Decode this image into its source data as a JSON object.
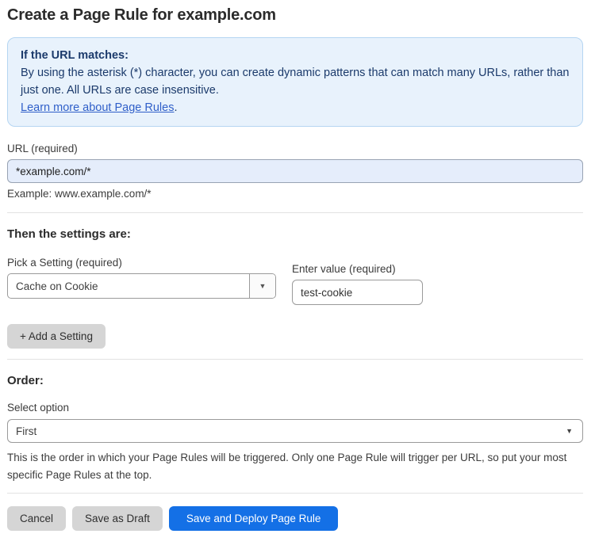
{
  "header": {
    "title": "Create a Page Rule for example.com"
  },
  "info_box": {
    "heading": "If the URL matches:",
    "body": "By using the asterisk (*) character, you can create dynamic patterns that can match many URLs, rather than just one. All URLs are case insensitive.",
    "link_label": "Learn more about Page Rules",
    "link_suffix": "."
  },
  "url_field": {
    "label": "URL (required)",
    "value": "*example.com/*",
    "example": "Example: www.example.com/*"
  },
  "settings_section": {
    "heading": "Then the settings are:",
    "setting_label": "Pick a Setting (required)",
    "setting_value": "Cache on Cookie",
    "value_label": "Enter value (required)",
    "value_input": "test-cookie",
    "add_button_label": "+ Add a Setting"
  },
  "order_section": {
    "heading": "Order:",
    "select_label": "Select option",
    "selected_option": "First",
    "help_text": "This is the order in which your Page Rules will be triggered. Only one Page Rule will trigger per URL, so put your most specific Page Rules at the top."
  },
  "actions": {
    "cancel_label": "Cancel",
    "save_draft_label": "Save as Draft",
    "save_deploy_label": "Save and Deploy Page Rule"
  },
  "icons": {
    "chevron_down": "▼"
  },
  "colors": {
    "accent_blue": "#1470e6",
    "info_bg": "#e8f2fc",
    "info_border": "#b5d5f2",
    "info_text": "#1b3a6b",
    "link_blue": "#2f5fc9",
    "input_highlight_bg": "#e5edfb",
    "gray_button_bg": "#d5d5d5"
  }
}
